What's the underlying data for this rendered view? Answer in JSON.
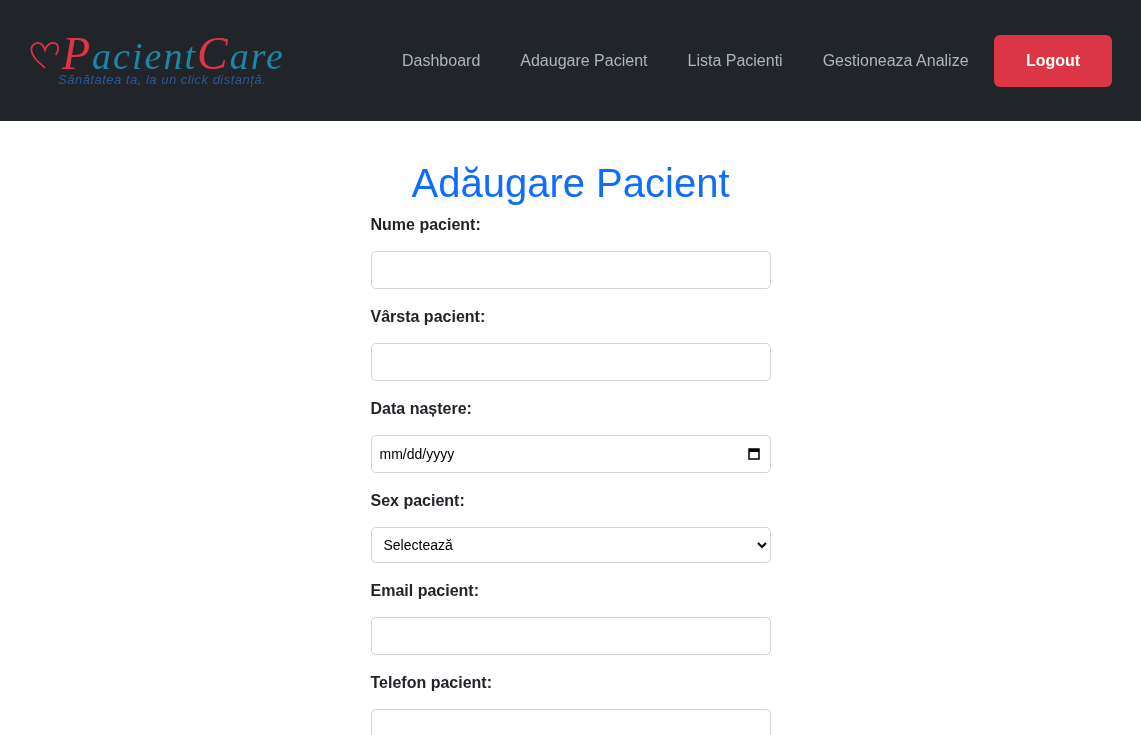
{
  "header": {
    "logo": {
      "word_1": "Pacient",
      "word_2": "Care",
      "tagline": "Sănătatea ta, la un click distanță."
    },
    "nav": [
      {
        "label": "Dashboard",
        "selected": false
      },
      {
        "label": "Adaugare Pacient",
        "selected": false
      },
      {
        "label": "Lista Pacienti",
        "selected": false
      },
      {
        "label": "Gestioneaza Analize",
        "selected": false
      }
    ],
    "logout": "Logout"
  },
  "title": "Adăugare Pacient",
  "fields": [
    {
      "kind": "text",
      "label": "Nume pacient:"
    },
    {
      "kind": "text",
      "label": "Vârsta pacient:"
    },
    {
      "kind": "date",
      "label": "Data naștere:",
      "placeholder": "mm/dd/yyyy"
    },
    {
      "kind": "select",
      "label": "Sex pacient:",
      "value": "Selectează"
    },
    {
      "kind": "text",
      "label": "Email pacient:"
    },
    {
      "kind": "text",
      "label": "Telefon pacient:"
    }
  ]
}
